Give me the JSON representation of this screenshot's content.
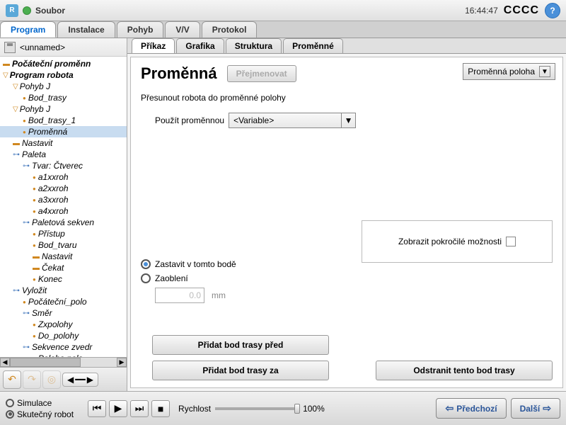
{
  "topbar": {
    "menu": "Soubor",
    "clock": "16:44:47",
    "indicator": "CCCC"
  },
  "main_tabs": [
    "Program",
    "Instalace",
    "Pohyb",
    "V/V",
    "Protokol"
  ],
  "main_tab_active": 0,
  "file_name": "<unnamed>",
  "tree": [
    {
      "d": 0,
      "ic": "dash",
      "t": "Počáteční proměnn",
      "cls": "bold"
    },
    {
      "d": 0,
      "ic": "tri",
      "t": "Program robota",
      "cls": "bold"
    },
    {
      "d": 1,
      "ic": "tri",
      "t": "Pohyb J",
      "cls": "italic"
    },
    {
      "d": 2,
      "ic": "dot",
      "t": "Bod_trasy",
      "cls": "italic"
    },
    {
      "d": 1,
      "ic": "tri",
      "t": "Pohyb J",
      "cls": "italic"
    },
    {
      "d": 2,
      "ic": "dot",
      "t": "Bod_trasy_1",
      "cls": "italic"
    },
    {
      "d": 2,
      "ic": "dot",
      "t": "Proměnná",
      "cls": "italic",
      "sel": true
    },
    {
      "d": 1,
      "ic": "dash",
      "t": "Nastavit",
      "cls": "italic"
    },
    {
      "d": 1,
      "ic": "link",
      "t": "Paleta",
      "cls": "italic"
    },
    {
      "d": 2,
      "ic": "link",
      "t": "Tvar: Čtverec",
      "cls": "italic"
    },
    {
      "d": 3,
      "ic": "dot",
      "t": "a1xxroh",
      "cls": "italic"
    },
    {
      "d": 3,
      "ic": "dot",
      "t": "a2xxroh",
      "cls": "italic"
    },
    {
      "d": 3,
      "ic": "dot",
      "t": "a3xxroh",
      "cls": "italic"
    },
    {
      "d": 3,
      "ic": "dot",
      "t": "a4xxroh",
      "cls": "italic"
    },
    {
      "d": 2,
      "ic": "link",
      "t": "Paletová sekven",
      "cls": "italic"
    },
    {
      "d": 3,
      "ic": "dot",
      "t": "Přístup",
      "cls": "italic"
    },
    {
      "d": 3,
      "ic": "dot",
      "t": "Bod_tvaru",
      "cls": "italic"
    },
    {
      "d": 3,
      "ic": "dash",
      "t": "Nastavit",
      "cls": "italic"
    },
    {
      "d": 3,
      "ic": "dash",
      "t": "Čekat",
      "cls": "italic"
    },
    {
      "d": 3,
      "ic": "dot",
      "t": "Konec",
      "cls": "italic"
    },
    {
      "d": 1,
      "ic": "link",
      "t": "Vyložit",
      "cls": "italic"
    },
    {
      "d": 2,
      "ic": "dot",
      "t": "Počáteční_polo",
      "cls": "italic"
    },
    {
      "d": 2,
      "ic": "link",
      "t": "Směr",
      "cls": "italic"
    },
    {
      "d": 3,
      "ic": "dot",
      "t": "Zxpolohy",
      "cls": "italic"
    },
    {
      "d": 3,
      "ic": "dot",
      "t": "Do_polohy",
      "cls": "italic"
    },
    {
      "d": 2,
      "ic": "link",
      "t": "Sekvence zvedr",
      "cls": "italic"
    },
    {
      "d": 3,
      "ic": "dot",
      "t": "Poloha nalo",
      "cls": "italic"
    }
  ],
  "sub_tabs": [
    "Příkaz",
    "Grafika",
    "Struktura",
    "Proměnné"
  ],
  "sub_tab_active": 0,
  "detail": {
    "title": "Proměnná",
    "rename": "Přejmenovat",
    "type_selector": "Proměnná poloha",
    "desc": "Přesunout robota do proměnné polohy",
    "use_var_label": "Použít proměnnou",
    "use_var_value": "<Variable>",
    "adv_label": "Zobrazit pokročilé možnosti",
    "radio_stop": "Zastavit v tomto bodě",
    "radio_blend": "Zaoblení",
    "blend_value": "0.0",
    "blend_unit": "mm",
    "btn_before": "Přidat bod trasy před",
    "btn_after": "Přidat bod trasy za",
    "btn_delete": "Odstranit tento bod trasy"
  },
  "bottom": {
    "sim": "Simulace",
    "real": "Skutečný robot",
    "speed_label": "Rychlost",
    "speed_value": "100%",
    "prev": "Předchozí",
    "next": "Další"
  }
}
